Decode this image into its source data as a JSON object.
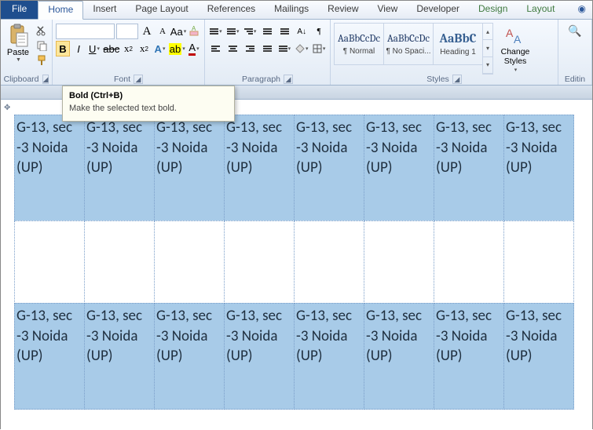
{
  "tabs": {
    "file": "File",
    "home": "Home",
    "insert": "Insert",
    "pageLayout": "Page Layout",
    "references": "References",
    "mailings": "Mailings",
    "review": "Review",
    "view": "View",
    "developer": "Developer",
    "design": "Design",
    "layout": "Layout"
  },
  "clipboard": {
    "paste": "Paste",
    "label": "Clipboard"
  },
  "font": {
    "label": "Font",
    "nameEmpty": "",
    "sizeEmpty": "",
    "grow": "A",
    "shrink": "A",
    "case": "Aa"
  },
  "paragraph": {
    "label": "Paragraph"
  },
  "styles": {
    "label": "Styles",
    "items": [
      {
        "preview": "AaBbCcDc",
        "name": "¶ Normal",
        "cls": ""
      },
      {
        "preview": "AaBbCcDc",
        "name": "¶ No Spaci...",
        "cls": ""
      },
      {
        "preview": "AaBbC",
        "name": "Heading 1",
        "cls": "h1"
      }
    ],
    "change": "Change Styles"
  },
  "editing": {
    "label": "Editin"
  },
  "tooltip": {
    "title": "Bold (Ctrl+B)",
    "body": "Make the selected text bold."
  },
  "cellText": "G-13, sec -3 Noida (UP)"
}
